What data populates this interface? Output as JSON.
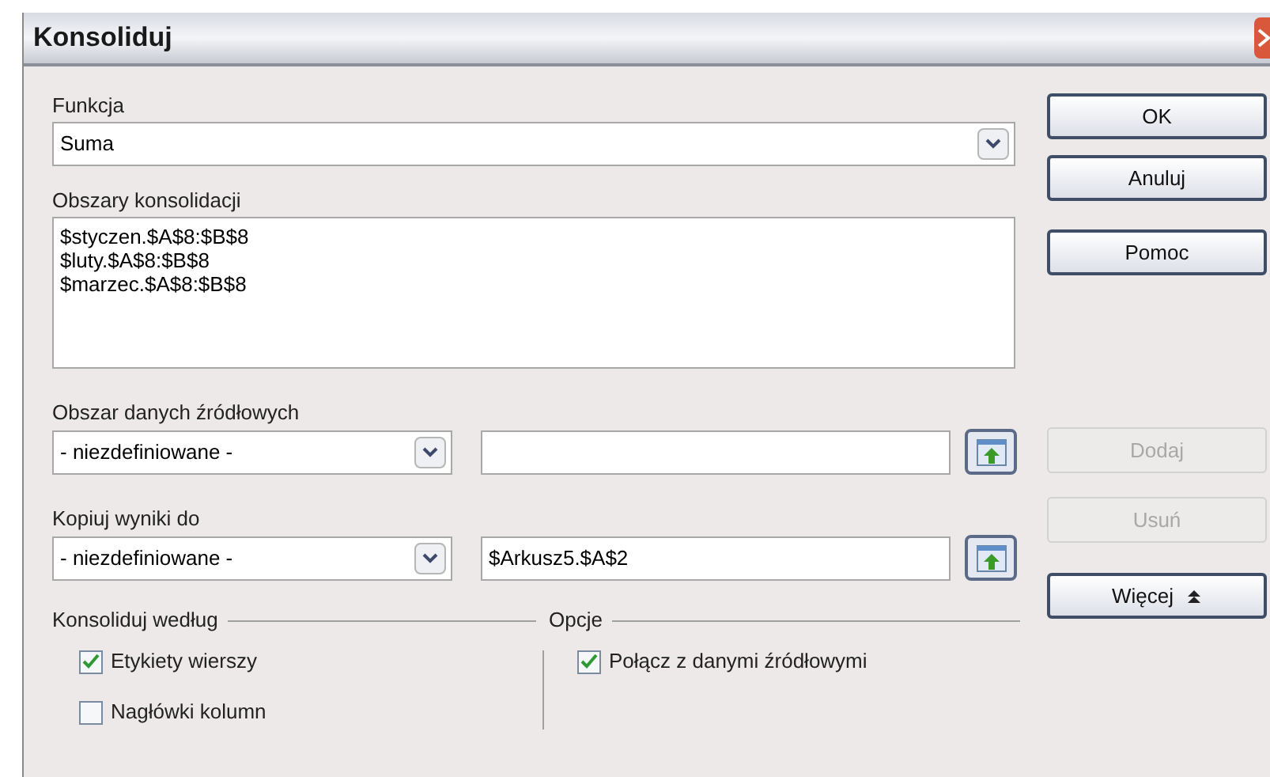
{
  "window": {
    "title": "Konsoliduj"
  },
  "function": {
    "label": "Funkcja",
    "value": "Suma"
  },
  "ranges": {
    "label": "Obszary konsolidacji",
    "lines": [
      "$styczen.$A$8:$B$8",
      "$luty.$A$8:$B$8",
      "$marzec.$A$8:$B$8"
    ]
  },
  "source": {
    "label": "Obszar danych źródłowych",
    "select": "- niezdefiniowane -"
  },
  "copy_to": {
    "label": "Kopiuj wyniki do",
    "select": "- niezdefiniowane -",
    "value": "$Arkusz5.$A$2"
  },
  "consolidate_by": {
    "label": "Konsoliduj według",
    "options": [
      {
        "label": "Etykiety wierszy",
        "checked": true
      },
      {
        "label": "Nagłówki kolumn",
        "checked": false
      }
    ]
  },
  "options": {
    "label": "Opcje",
    "options": [
      {
        "label": "Połącz z danymi źródłowymi",
        "checked": true
      }
    ]
  },
  "buttons": [
    {
      "label": "OK",
      "disabled": false,
      "kind": "push"
    },
    {
      "label": "Anuluj",
      "disabled": false,
      "kind": "push"
    },
    {
      "label": "Pomoc",
      "disabled": false,
      "kind": "push"
    },
    {
      "label": "Dodaj",
      "disabled": true,
      "kind": "push"
    },
    {
      "label": "Usuń",
      "disabled": true,
      "kind": "push"
    },
    {
      "label": "Więcej",
      "disabled": false,
      "kind": "more"
    }
  ]
}
